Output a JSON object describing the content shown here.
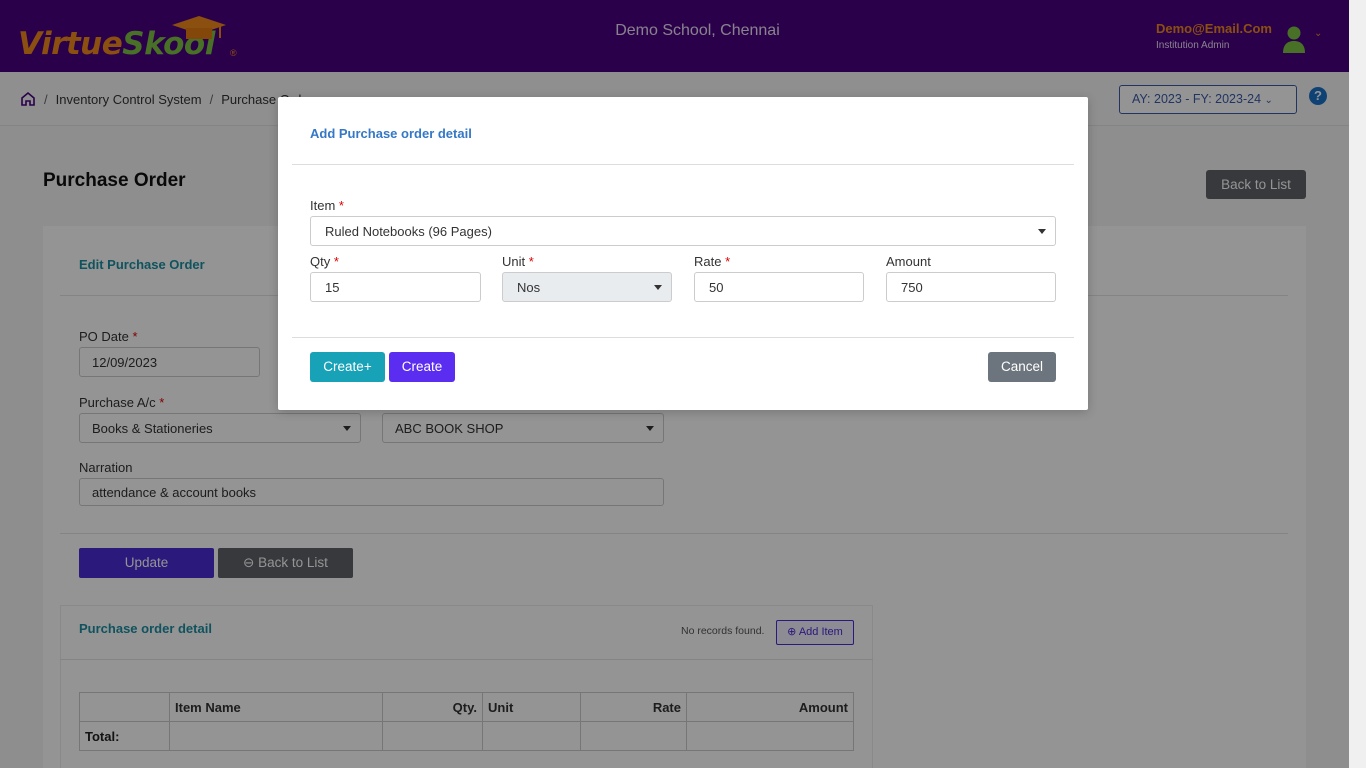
{
  "header": {
    "logo_virtue": "Virtue",
    "logo_skool": "Skool",
    "logo_reg": "®",
    "school_name": "Demo School, Chennai",
    "user_email": "Demo@Email.Com",
    "user_role": "Institution Admin"
  },
  "breadcrumb": {
    "items": [
      "Inventory Control System",
      "Purchase Order"
    ],
    "separator": "/"
  },
  "academic_year": "AY: 2023 - FY: 2023-24",
  "help_label": "?",
  "page": {
    "title": "Purchase Order",
    "back_to_list_top": "Back to List"
  },
  "edit_form": {
    "section_title": "Edit Purchase Order",
    "po_date_label": "PO Date",
    "po_date_value": "12/09/2023",
    "purchase_ac_label": "Purchase A/c",
    "purchase_ac_value": "Books & Stationeries",
    "supplier_value": "ABC BOOK SHOP",
    "narration_label": "Narration",
    "narration_value": "attendance & account books",
    "update_label": "Update",
    "back_label": "Back to List",
    "required_mark": "*"
  },
  "detail": {
    "section_title": "Purchase order detail",
    "no_records": "No records found.",
    "add_item": "Add Item",
    "columns": [
      "",
      "Item Name",
      "Qty.",
      "Unit",
      "Rate",
      "Amount"
    ],
    "total_label": "Total:"
  },
  "modal": {
    "title": "Add Purchase order detail",
    "item_label": "Item",
    "item_value": "Ruled Notebooks (96 Pages)",
    "qty_label": "Qty",
    "qty_value": "15",
    "unit_label": "Unit",
    "unit_value": "Nos",
    "rate_label": "Rate",
    "rate_value": "50",
    "amount_label": "Amount",
    "amount_value": "750",
    "create_plus": "Create+",
    "create": "Create",
    "cancel": "Cancel",
    "required_mark": "*"
  },
  "colors": {
    "header_bg": "#4b0082",
    "accent_orange": "#f08a1c",
    "accent_green": "#7cc142",
    "primary_purple": "#5b2df0",
    "info_teal": "#17a2b8",
    "secondary_gray": "#6c757d",
    "link_blue": "#3478c6"
  }
}
